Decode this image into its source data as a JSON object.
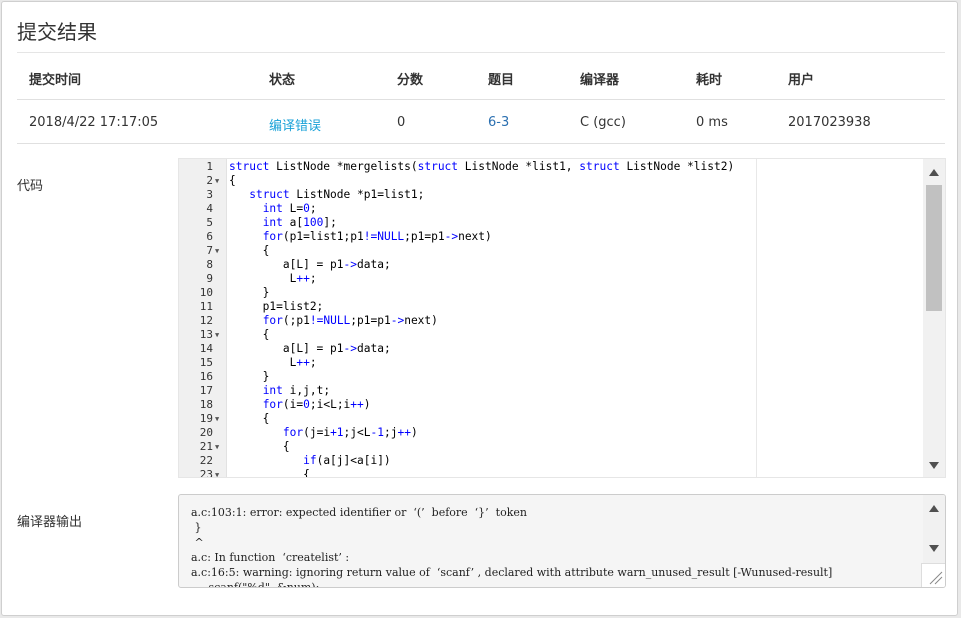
{
  "dialog": {
    "title": "提交结果"
  },
  "table": {
    "headers": [
      "提交时间",
      "状态",
      "分数",
      "题目",
      "编译器",
      "耗时",
      "用户"
    ],
    "row": [
      "2018/4/22 17:17:05",
      "编译错误",
      "0",
      "6-3",
      "C (gcc)",
      "0 ms",
      "2017023938"
    ]
  },
  "sections": {
    "code_label": "代码",
    "compiler_output_label": "编译器输出"
  },
  "code": {
    "lines": [
      {
        "n": "1",
        "fold": "",
        "text": [
          [
            "kw",
            "struct"
          ],
          [
            "",
            " ListNode *mergelists("
          ],
          [
            "kw",
            "struct"
          ],
          [
            "",
            " ListNode *list1, "
          ],
          [
            "kw",
            "struct"
          ],
          [
            "",
            " ListNode *list2)"
          ]
        ]
      },
      {
        "n": "2",
        "fold": "▼",
        "text": [
          [
            "",
            "{"
          ]
        ]
      },
      {
        "n": "3",
        "fold": "",
        "text": [
          [
            "",
            "   "
          ],
          [
            "kw",
            "struct"
          ],
          [
            "",
            " ListNode *p1=list1;"
          ]
        ]
      },
      {
        "n": "4",
        "fold": "",
        "text": [
          [
            "",
            "     "
          ],
          [
            "kw",
            "int"
          ],
          [
            "",
            " L="
          ],
          [
            "kw",
            "0"
          ],
          [
            "",
            ";"
          ]
        ]
      },
      {
        "n": "5",
        "fold": "",
        "text": [
          [
            "",
            "     "
          ],
          [
            "kw",
            "int"
          ],
          [
            "",
            " a["
          ],
          [
            "kw",
            "100"
          ],
          [
            "",
            "];"
          ]
        ]
      },
      {
        "n": "6",
        "fold": "",
        "text": [
          [
            "",
            "     "
          ],
          [
            "kw",
            "for"
          ],
          [
            "",
            "(p1=list1;p1"
          ],
          [
            "kw",
            "!="
          ],
          [
            "kw",
            "NULL"
          ],
          [
            "",
            ";p1=p1"
          ],
          [
            "kw",
            "->"
          ],
          [
            "",
            "next)"
          ]
        ]
      },
      {
        "n": "7",
        "fold": "▼",
        "text": [
          [
            "",
            "     {"
          ]
        ]
      },
      {
        "n": "8",
        "fold": "",
        "text": [
          [
            "",
            "        a[L] = p1"
          ],
          [
            "kw",
            "->"
          ],
          [
            "",
            "data;"
          ]
        ]
      },
      {
        "n": "9",
        "fold": "",
        "text": [
          [
            "",
            "         L"
          ],
          [
            "kw",
            "++"
          ],
          [
            "",
            ";"
          ]
        ]
      },
      {
        "n": "10",
        "fold": "",
        "text": [
          [
            "",
            "     }"
          ]
        ]
      },
      {
        "n": "11",
        "fold": "",
        "text": [
          [
            "",
            "     p1=list2;"
          ]
        ]
      },
      {
        "n": "12",
        "fold": "",
        "text": [
          [
            "",
            "     "
          ],
          [
            "kw",
            "for"
          ],
          [
            "",
            "(;p1"
          ],
          [
            "kw",
            "!="
          ],
          [
            "kw",
            "NULL"
          ],
          [
            "",
            ";p1=p1"
          ],
          [
            "kw",
            "->"
          ],
          [
            "",
            "next)"
          ]
        ]
      },
      {
        "n": "13",
        "fold": "▼",
        "text": [
          [
            "",
            "     {"
          ]
        ]
      },
      {
        "n": "14",
        "fold": "",
        "text": [
          [
            "",
            "        a[L] = p1"
          ],
          [
            "kw",
            "->"
          ],
          [
            "",
            "data;"
          ]
        ]
      },
      {
        "n": "15",
        "fold": "",
        "text": [
          [
            "",
            "         L"
          ],
          [
            "kw",
            "++"
          ],
          [
            "",
            ";"
          ]
        ]
      },
      {
        "n": "16",
        "fold": "",
        "text": [
          [
            "",
            "     }"
          ]
        ]
      },
      {
        "n": "17",
        "fold": "",
        "text": [
          [
            "",
            "     "
          ],
          [
            "kw",
            "int"
          ],
          [
            "",
            " i,j,t;"
          ]
        ]
      },
      {
        "n": "18",
        "fold": "",
        "text": [
          [
            "",
            "     "
          ],
          [
            "kw",
            "for"
          ],
          [
            "",
            "(i="
          ],
          [
            "kw",
            "0"
          ],
          [
            "",
            ";i<L;i"
          ],
          [
            "kw",
            "++"
          ],
          [
            "",
            ")"
          ]
        ]
      },
      {
        "n": "19",
        "fold": "▼",
        "text": [
          [
            "",
            "     {"
          ]
        ]
      },
      {
        "n": "20",
        "fold": "",
        "text": [
          [
            "",
            "        "
          ],
          [
            "kw",
            "for"
          ],
          [
            "",
            "(j=i"
          ],
          [
            "kw",
            "+1"
          ],
          [
            "",
            ";j<L"
          ],
          [
            "kw",
            "-1"
          ],
          [
            "",
            ";j"
          ],
          [
            "kw",
            "++"
          ],
          [
            "",
            ")"
          ]
        ]
      },
      {
        "n": "21",
        "fold": "▼",
        "text": [
          [
            "",
            "        {"
          ]
        ]
      },
      {
        "n": "22",
        "fold": "",
        "text": [
          [
            "",
            "           "
          ],
          [
            "kw",
            "if"
          ],
          [
            "",
            "(a[j]<a[i])"
          ]
        ]
      },
      {
        "n": "23",
        "fold": "▼",
        "text": [
          [
            "",
            "           {"
          ]
        ]
      }
    ]
  },
  "compiler_output": {
    "lines": [
      "a.c:103:1: error: expected identifier or  ‘(’  before  ‘}’  token",
      " }",
      " ^",
      "a.c: In function  ‘createlist’ :",
      "a.c:16:5: warning: ignoring return value of  ‘scanf’ , declared with attribute warn_unused_result [-Wunused-result]",
      "     scanf(\"%d\", &num);"
    ]
  }
}
